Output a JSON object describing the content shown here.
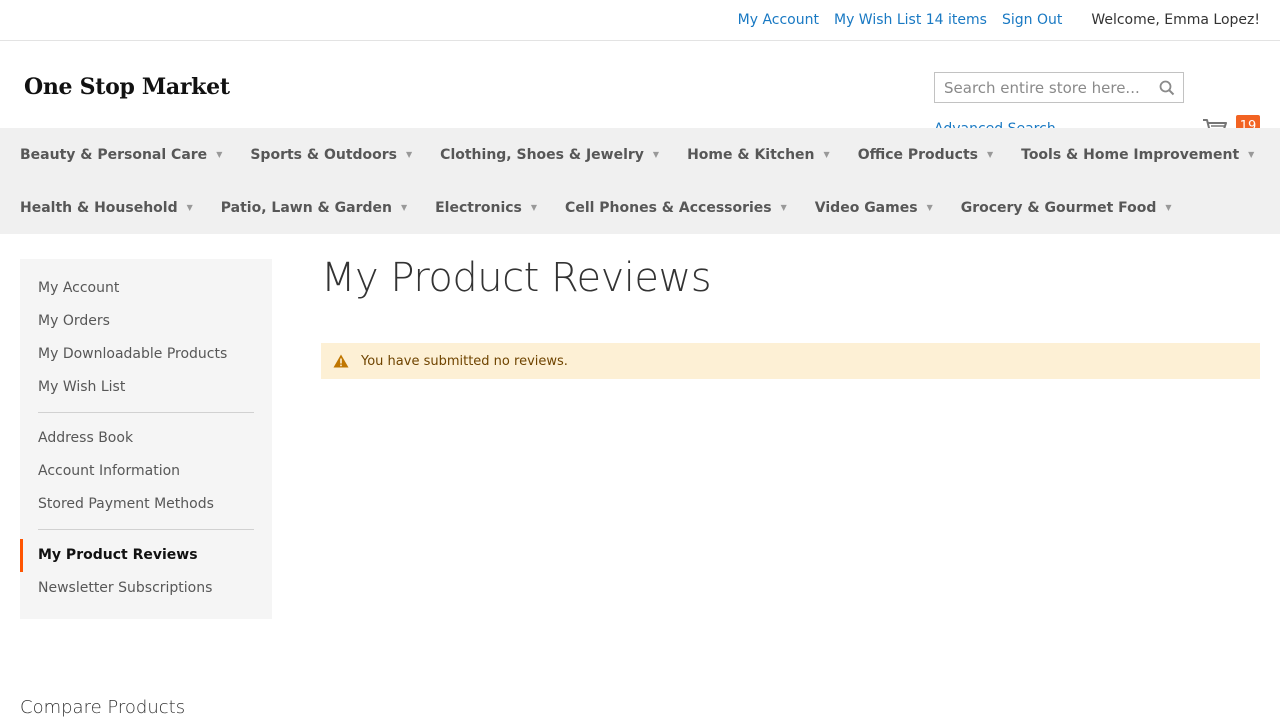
{
  "top_links": {
    "my_account": "My Account",
    "wish_list": "My Wish List 14 items",
    "sign_out": "Sign Out",
    "welcome": "Welcome, Emma Lopez!"
  },
  "header": {
    "logo": "One Stop Market",
    "search_placeholder": "Search entire store here...",
    "advanced_search": "Advanced Search",
    "cart_count": "19"
  },
  "nav": {
    "row1": [
      {
        "label": "Beauty & Personal Care"
      },
      {
        "label": "Sports & Outdoors"
      },
      {
        "label": "Clothing, Shoes & Jewelry"
      },
      {
        "label": "Home & Kitchen"
      },
      {
        "label": "Office Products"
      },
      {
        "label": "Tools & Home Improvement"
      }
    ],
    "row2": [
      {
        "label": "Health & Household"
      },
      {
        "label": "Patio, Lawn & Garden"
      },
      {
        "label": "Electronics"
      },
      {
        "label": "Cell Phones & Accessories"
      },
      {
        "label": "Video Games"
      },
      {
        "label": "Grocery & Gourmet Food"
      }
    ]
  },
  "sidebar": {
    "items": [
      {
        "label": "My Account"
      },
      {
        "label": "My Orders"
      },
      {
        "label": "My Downloadable Products"
      },
      {
        "label": "My Wish List"
      },
      {
        "label": "Address Book"
      },
      {
        "label": "Account Information"
      },
      {
        "label": "Stored Payment Methods"
      },
      {
        "label": "My Product Reviews"
      },
      {
        "label": "Newsletter Subscriptions"
      }
    ]
  },
  "main": {
    "title": "My Product Reviews",
    "message": "You have submitted no reviews."
  },
  "compare": {
    "title": "Compare Products"
  },
  "colors": {
    "link": "#1979c3",
    "accent": "#f26322",
    "warning_bg": "#fdf0d5"
  }
}
